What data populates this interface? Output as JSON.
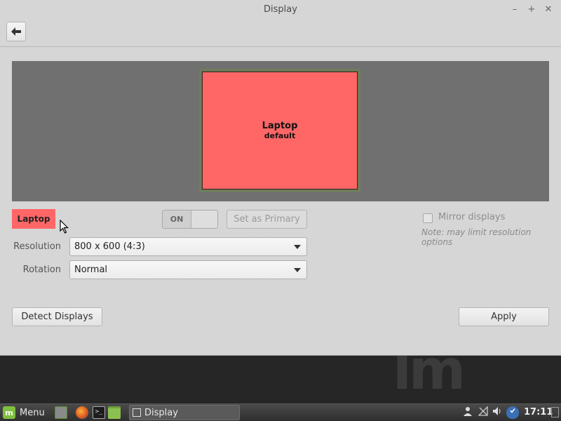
{
  "window": {
    "title": "Display",
    "controls": {
      "minimize": "–",
      "maximize": "+",
      "close": "✕"
    }
  },
  "toolbar": {
    "back_icon": "arrow-left-icon"
  },
  "preview": {
    "monitor_name": "Laptop",
    "monitor_sub": "default",
    "monitor_color": "#ff6767"
  },
  "output": {
    "name": "Laptop",
    "switch_label": "ON",
    "set_primary_label": "Set as Primary"
  },
  "mirror": {
    "label": "Mirror displays",
    "note": "Note: may limit resolution options",
    "checked": false
  },
  "settings": {
    "resolution_label": "Resolution",
    "resolution_value": "800 x 600 (4:3)",
    "rotation_label": "Rotation",
    "rotation_value": "Normal"
  },
  "actions": {
    "detect_label": "Detect Displays",
    "apply_label": "Apply"
  },
  "taskbar": {
    "menu_label": "Menu",
    "task_display_label": "Display",
    "clock": "17:11",
    "terminal_glyph": ">_"
  }
}
